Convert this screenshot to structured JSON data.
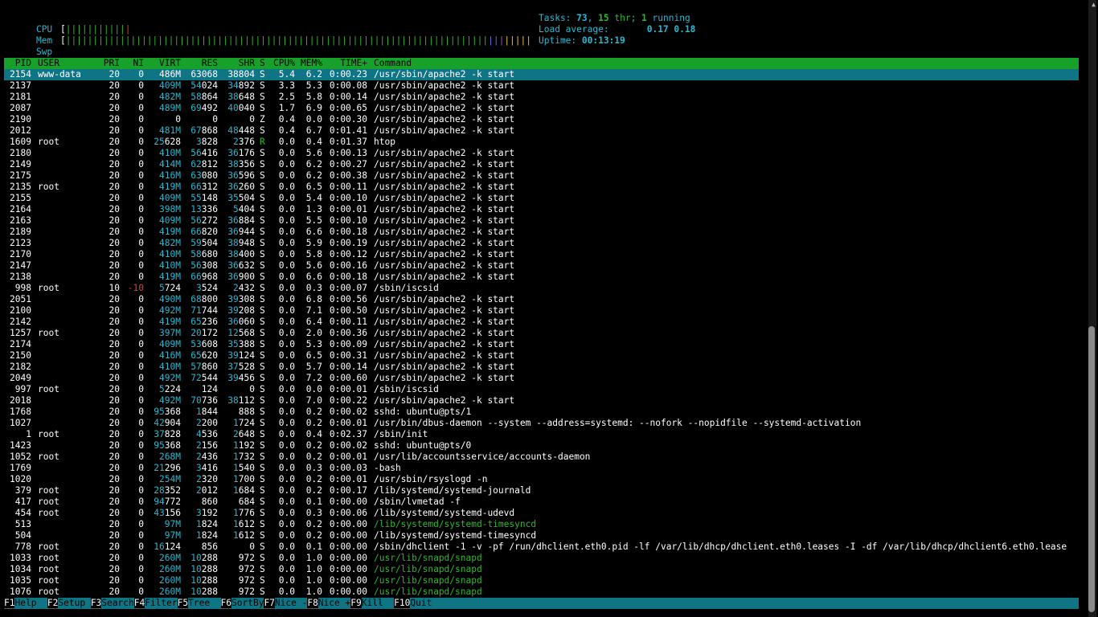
{
  "meters": {
    "cpu": {
      "label": "CPU",
      "bars": [
        {
          "text": "|||||||||||",
          "color": "#2eb82e"
        },
        {
          "text": "|",
          "color": "#e23b3b"
        }
      ]
    },
    "mem": {
      "label": "Mem",
      "bars": [
        {
          "text": "||||||||||||||||||||||||||||||||||||||||||||||||||||||||||||||||||||||||||||||",
          "color": "#2eb82e"
        },
        {
          "text": "||",
          "color": "#5a6fe8"
        },
        {
          "text": "|",
          "color": "#b24bd6"
        },
        {
          "text": "|||||",
          "color": "#e6c13a"
        }
      ]
    },
    "swp": {
      "label": "Swp",
      "bars": []
    }
  },
  "tasks": {
    "label": "Tasks: ",
    "count": "73",
    "sep": ", ",
    "threads": "15",
    "thr_label": " thr",
    "sep2": "; ",
    "running": "1",
    "running_label": " running",
    "load_label": "Load average: ",
    "load1": "0.17",
    "load2": "0.18",
    "uptime_label": "Uptime: ",
    "uptime": "00:13:19"
  },
  "columns": [
    "PID",
    "USER",
    "PRI",
    "NI",
    "VIRT",
    "RES",
    "SHR",
    "S",
    "CPU%",
    "MEM%",
    "TIME+",
    "Command"
  ],
  "processes": [
    {
      "pid": "2154",
      "user": "www-data",
      "pri": "20",
      "ni": "0",
      "virt": "486M",
      "res": "63068",
      "shr": "38804",
      "s": "S",
      "cpu": "5.4",
      "mem": "6.2",
      "time": "0:00.23",
      "cmd": "/usr/sbin/apache2 -k start",
      "selected": true
    },
    {
      "pid": "2137",
      "user": "",
      "pri": "20",
      "ni": "0",
      "virt": "409M",
      "res": "54024",
      "shr": "34892",
      "s": "S",
      "cpu": "3.3",
      "mem": "5.3",
      "time": "0:00.08",
      "cmd": "/usr/sbin/apache2 -k start"
    },
    {
      "pid": "2181",
      "user": "",
      "pri": "20",
      "ni": "0",
      "virt": "482M",
      "res": "58864",
      "shr": "38648",
      "s": "S",
      "cpu": "2.5",
      "mem": "5.8",
      "time": "0:00.14",
      "cmd": "/usr/sbin/apache2 -k start"
    },
    {
      "pid": "2087",
      "user": "",
      "pri": "20",
      "ni": "0",
      "virt": "489M",
      "res": "69492",
      "shr": "40040",
      "s": "S",
      "cpu": "1.7",
      "mem": "6.9",
      "time": "0:00.65",
      "cmd": "/usr/sbin/apache2 -k start"
    },
    {
      "pid": "2190",
      "user": "",
      "pri": "20",
      "ni": "0",
      "virt": "0",
      "res": "0",
      "shr": "0",
      "s": "Z",
      "cpu": "0.4",
      "mem": "0.0",
      "time": "0:00.30",
      "cmd": "/usr/sbin/apache2 -k start"
    },
    {
      "pid": "2012",
      "user": "",
      "pri": "20",
      "ni": "0",
      "virt": "481M",
      "res": "67868",
      "shr": "48448",
      "s": "S",
      "cpu": "0.4",
      "mem": "6.7",
      "time": "0:01.41",
      "cmd": "/usr/sbin/apache2 -k start"
    },
    {
      "pid": "1609",
      "user": "root",
      "pri": "20",
      "ni": "0",
      "virt": "25628",
      "res": "3828",
      "shr": "2376",
      "s": "R",
      "cpu": "0.0",
      "mem": "0.4",
      "time": "0:01.37",
      "cmd": "htop"
    },
    {
      "pid": "2180",
      "user": "",
      "pri": "20",
      "ni": "0",
      "virt": "410M",
      "res": "56416",
      "shr": "36176",
      "s": "S",
      "cpu": "0.0",
      "mem": "5.6",
      "time": "0:00.13",
      "cmd": "/usr/sbin/apache2 -k start"
    },
    {
      "pid": "2149",
      "user": "",
      "pri": "20",
      "ni": "0",
      "virt": "414M",
      "res": "62812",
      "shr": "38356",
      "s": "S",
      "cpu": "0.0",
      "mem": "6.2",
      "time": "0:00.27",
      "cmd": "/usr/sbin/apache2 -k start"
    },
    {
      "pid": "2175",
      "user": "",
      "pri": "20",
      "ni": "0",
      "virt": "416M",
      "res": "63080",
      "shr": "36596",
      "s": "S",
      "cpu": "0.0",
      "mem": "6.2",
      "time": "0:00.38",
      "cmd": "/usr/sbin/apache2 -k start"
    },
    {
      "pid": "2135",
      "user": "root",
      "pri": "20",
      "ni": "0",
      "virt": "419M",
      "res": "66312",
      "shr": "36260",
      "s": "S",
      "cpu": "0.0",
      "mem": "6.5",
      "time": "0:00.11",
      "cmd": "/usr/sbin/apache2 -k start"
    },
    {
      "pid": "2155",
      "user": "",
      "pri": "20",
      "ni": "0",
      "virt": "409M",
      "res": "55148",
      "shr": "35504",
      "s": "S",
      "cpu": "0.0",
      "mem": "5.4",
      "time": "0:00.10",
      "cmd": "/usr/sbin/apache2 -k start"
    },
    {
      "pid": "2164",
      "user": "",
      "pri": "20",
      "ni": "0",
      "virt": "398M",
      "res": "13336",
      "shr": "5404",
      "s": "S",
      "cpu": "0.0",
      "mem": "1.3",
      "time": "0:00.01",
      "cmd": "/usr/sbin/apache2 -k start"
    },
    {
      "pid": "2163",
      "user": "",
      "pri": "20",
      "ni": "0",
      "virt": "409M",
      "res": "56272",
      "shr": "36884",
      "s": "S",
      "cpu": "0.0",
      "mem": "5.5",
      "time": "0:00.10",
      "cmd": "/usr/sbin/apache2 -k start"
    },
    {
      "pid": "2189",
      "user": "",
      "pri": "20",
      "ni": "0",
      "virt": "419M",
      "res": "66820",
      "shr": "36944",
      "s": "S",
      "cpu": "0.0",
      "mem": "6.6",
      "time": "0:00.18",
      "cmd": "/usr/sbin/apache2 -k start"
    },
    {
      "pid": "2123",
      "user": "",
      "pri": "20",
      "ni": "0",
      "virt": "482M",
      "res": "59504",
      "shr": "38948",
      "s": "S",
      "cpu": "0.0",
      "mem": "5.9",
      "time": "0:00.19",
      "cmd": "/usr/sbin/apache2 -k start"
    },
    {
      "pid": "2170",
      "user": "",
      "pri": "20",
      "ni": "0",
      "virt": "410M",
      "res": "58680",
      "shr": "38400",
      "s": "S",
      "cpu": "0.0",
      "mem": "5.8",
      "time": "0:00.12",
      "cmd": "/usr/sbin/apache2 -k start"
    },
    {
      "pid": "2147",
      "user": "",
      "pri": "20",
      "ni": "0",
      "virt": "410M",
      "res": "56308",
      "shr": "36632",
      "s": "S",
      "cpu": "0.0",
      "mem": "5.6",
      "time": "0:00.16",
      "cmd": "/usr/sbin/apache2 -k start"
    },
    {
      "pid": "2138",
      "user": "",
      "pri": "20",
      "ni": "0",
      "virt": "419M",
      "res": "66968",
      "shr": "36900",
      "s": "S",
      "cpu": "0.0",
      "mem": "6.6",
      "time": "0:00.18",
      "cmd": "/usr/sbin/apache2 -k start"
    },
    {
      "pid": "998",
      "user": "root",
      "pri": "10",
      "ni": "-10",
      "virt": "5724",
      "res": "3524",
      "shr": "2432",
      "s": "S",
      "cpu": "0.0",
      "mem": "0.3",
      "time": "0:00.07",
      "cmd": "/sbin/iscsid"
    },
    {
      "pid": "2051",
      "user": "",
      "pri": "20",
      "ni": "0",
      "virt": "490M",
      "res": "68800",
      "shr": "39308",
      "s": "S",
      "cpu": "0.0",
      "mem": "6.8",
      "time": "0:00.56",
      "cmd": "/usr/sbin/apache2 -k start"
    },
    {
      "pid": "2100",
      "user": "",
      "pri": "20",
      "ni": "0",
      "virt": "492M",
      "res": "71744",
      "shr": "39208",
      "s": "S",
      "cpu": "0.0",
      "mem": "7.1",
      "time": "0:00.50",
      "cmd": "/usr/sbin/apache2 -k start"
    },
    {
      "pid": "2142",
      "user": "",
      "pri": "20",
      "ni": "0",
      "virt": "419M",
      "res": "65236",
      "shr": "36060",
      "s": "S",
      "cpu": "0.0",
      "mem": "6.4",
      "time": "0:00.11",
      "cmd": "/usr/sbin/apache2 -k start"
    },
    {
      "pid": "1257",
      "user": "root",
      "pri": "20",
      "ni": "0",
      "virt": "397M",
      "res": "20172",
      "shr": "12568",
      "s": "S",
      "cpu": "0.0",
      "mem": "2.0",
      "time": "0:00.36",
      "cmd": "/usr/sbin/apache2 -k start"
    },
    {
      "pid": "2174",
      "user": "",
      "pri": "20",
      "ni": "0",
      "virt": "409M",
      "res": "53608",
      "shr": "35388",
      "s": "S",
      "cpu": "0.0",
      "mem": "5.3",
      "time": "0:00.09",
      "cmd": "/usr/sbin/apache2 -k start"
    },
    {
      "pid": "2150",
      "user": "",
      "pri": "20",
      "ni": "0",
      "virt": "416M",
      "res": "65620",
      "shr": "39124",
      "s": "S",
      "cpu": "0.0",
      "mem": "6.5",
      "time": "0:00.31",
      "cmd": "/usr/sbin/apache2 -k start"
    },
    {
      "pid": "2182",
      "user": "",
      "pri": "20",
      "ni": "0",
      "virt": "410M",
      "res": "57860",
      "shr": "37528",
      "s": "S",
      "cpu": "0.0",
      "mem": "5.7",
      "time": "0:00.14",
      "cmd": "/usr/sbin/apache2 -k start"
    },
    {
      "pid": "2049",
      "user": "",
      "pri": "20",
      "ni": "0",
      "virt": "492M",
      "res": "72544",
      "shr": "39456",
      "s": "S",
      "cpu": "0.0",
      "mem": "7.2",
      "time": "0:00.60",
      "cmd": "/usr/sbin/apache2 -k start"
    },
    {
      "pid": "997",
      "user": "root",
      "pri": "20",
      "ni": "0",
      "virt": "5224",
      "res": "124",
      "shr": "0",
      "s": "S",
      "cpu": "0.0",
      "mem": "0.0",
      "time": "0:00.01",
      "cmd": "/sbin/iscsid"
    },
    {
      "pid": "2018",
      "user": "",
      "pri": "20",
      "ni": "0",
      "virt": "492M",
      "res": "70736",
      "shr": "38112",
      "s": "S",
      "cpu": "0.0",
      "mem": "7.0",
      "time": "0:00.22",
      "cmd": "/usr/sbin/apache2 -k start"
    },
    {
      "pid": "1768",
      "user": "",
      "pri": "20",
      "ni": "0",
      "virt": "95368",
      "res": "1844",
      "shr": "888",
      "s": "S",
      "cpu": "0.0",
      "mem": "0.2",
      "time": "0:00.02",
      "cmd": "sshd: ubuntu@pts/1"
    },
    {
      "pid": "1027",
      "user": "",
      "pri": "20",
      "ni": "0",
      "virt": "42904",
      "res": "2200",
      "shr": "1724",
      "s": "S",
      "cpu": "0.0",
      "mem": "0.2",
      "time": "0:00.01",
      "cmd": "/usr/bin/dbus-daemon --system --address=systemd: --nofork --nopidfile --systemd-activation"
    },
    {
      "pid": "1",
      "user": "root",
      "pri": "20",
      "ni": "0",
      "virt": "37828",
      "res": "4536",
      "shr": "2648",
      "s": "S",
      "cpu": "0.0",
      "mem": "0.4",
      "time": "0:02.37",
      "cmd": "/sbin/init"
    },
    {
      "pid": "1423",
      "user": "",
      "pri": "20",
      "ni": "0",
      "virt": "95368",
      "res": "2156",
      "shr": "1192",
      "s": "S",
      "cpu": "0.0",
      "mem": "0.2",
      "time": "0:00.02",
      "cmd": "sshd: ubuntu@pts/0"
    },
    {
      "pid": "1052",
      "user": "root",
      "pri": "20",
      "ni": "0",
      "virt": "268M",
      "res": "2436",
      "shr": "1732",
      "s": "S",
      "cpu": "0.0",
      "mem": "0.2",
      "time": "0:00.01",
      "cmd": "/usr/lib/accountsservice/accounts-daemon"
    },
    {
      "pid": "1769",
      "user": "",
      "pri": "20",
      "ni": "0",
      "virt": "21296",
      "res": "3416",
      "shr": "1540",
      "s": "S",
      "cpu": "0.0",
      "mem": "0.3",
      "time": "0:00.03",
      "cmd": "-bash"
    },
    {
      "pid": "1020",
      "user": "",
      "pri": "20",
      "ni": "0",
      "virt": "254M",
      "res": "2320",
      "shr": "1700",
      "s": "S",
      "cpu": "0.0",
      "mem": "0.2",
      "time": "0:00.01",
      "cmd": "/usr/sbin/rsyslogd -n"
    },
    {
      "pid": "379",
      "user": "root",
      "pri": "20",
      "ni": "0",
      "virt": "28352",
      "res": "2012",
      "shr": "1684",
      "s": "S",
      "cpu": "0.0",
      "mem": "0.2",
      "time": "0:00.17",
      "cmd": "/lib/systemd/systemd-journald"
    },
    {
      "pid": "417",
      "user": "root",
      "pri": "20",
      "ni": "0",
      "virt": "94772",
      "res": "860",
      "shr": "684",
      "s": "S",
      "cpu": "0.0",
      "mem": "0.1",
      "time": "0:00.00",
      "cmd": "/sbin/lvmetad -f"
    },
    {
      "pid": "454",
      "user": "root",
      "pri": "20",
      "ni": "0",
      "virt": "43156",
      "res": "3192",
      "shr": "1776",
      "s": "S",
      "cpu": "0.0",
      "mem": "0.3",
      "time": "0:00.06",
      "cmd": "/lib/systemd/systemd-udevd"
    },
    {
      "pid": "513",
      "user": "",
      "pri": "20",
      "ni": "0",
      "virt": "97M",
      "res": "1824",
      "shr": "1612",
      "s": "S",
      "cpu": "0.0",
      "mem": "0.2",
      "time": "0:00.00",
      "cmd": "/lib/systemd/systemd-timesyncd",
      "thread": true
    },
    {
      "pid": "504",
      "user": "",
      "pri": "20",
      "ni": "0",
      "virt": "97M",
      "res": "1824",
      "shr": "1612",
      "s": "S",
      "cpu": "0.0",
      "mem": "0.2",
      "time": "0:00.00",
      "cmd": "/lib/systemd/systemd-timesyncd"
    },
    {
      "pid": "778",
      "user": "root",
      "pri": "20",
      "ni": "0",
      "virt": "16124",
      "res": "856",
      "shr": "0",
      "s": "S",
      "cpu": "0.0",
      "mem": "0.1",
      "time": "0:00.00",
      "cmd": "/sbin/dhclient -1 -v -pf /run/dhclient.eth0.pid -lf /var/lib/dhcp/dhclient.eth0.leases -I -df /var/lib/dhcp/dhclient6.eth0.lease"
    },
    {
      "pid": "1033",
      "user": "root",
      "pri": "20",
      "ni": "0",
      "virt": "260M",
      "res": "10288",
      "shr": "972",
      "s": "S",
      "cpu": "0.0",
      "mem": "1.0",
      "time": "0:00.00",
      "cmd": "/usr/lib/snapd/snapd",
      "thread": true
    },
    {
      "pid": "1034",
      "user": "root",
      "pri": "20",
      "ni": "0",
      "virt": "260M",
      "res": "10288",
      "shr": "972",
      "s": "S",
      "cpu": "0.0",
      "mem": "1.0",
      "time": "0:00.00",
      "cmd": "/usr/lib/snapd/snapd",
      "thread": true
    },
    {
      "pid": "1035",
      "user": "root",
      "pri": "20",
      "ni": "0",
      "virt": "260M",
      "res": "10288",
      "shr": "972",
      "s": "S",
      "cpu": "0.0",
      "mem": "1.0",
      "time": "0:00.00",
      "cmd": "/usr/lib/snapd/snapd",
      "thread": true
    },
    {
      "pid": "1076",
      "user": "root",
      "pri": "20",
      "ni": "0",
      "virt": "260M",
      "res": "10288",
      "shr": "972",
      "s": "S",
      "cpu": "0.0",
      "mem": "1.0",
      "time": "0:00.00",
      "cmd": "/usr/lib/snapd/snapd",
      "thread": true
    }
  ],
  "fkeys": [
    {
      "key": "F1",
      "label": "Help"
    },
    {
      "key": "F2",
      "label": "Setup"
    },
    {
      "key": "F3",
      "label": "Search"
    },
    {
      "key": "F4",
      "label": "Filter"
    },
    {
      "key": "F5",
      "label": "Tree"
    },
    {
      "key": "F6",
      "label": "SortBy"
    },
    {
      "key": "F7",
      "label": "Nice -"
    },
    {
      "key": "F8",
      "label": "Nice +"
    },
    {
      "key": "F9",
      "label": "Kill"
    },
    {
      "key": "F10",
      "label": "Quit"
    }
  ],
  "colors": {
    "header_bg": "#17a12a",
    "selected_bg": "#0f7585",
    "accent": "#2ab7cf",
    "thread_green": "#2eb82e",
    "negative_red": "#e23b3b"
  }
}
